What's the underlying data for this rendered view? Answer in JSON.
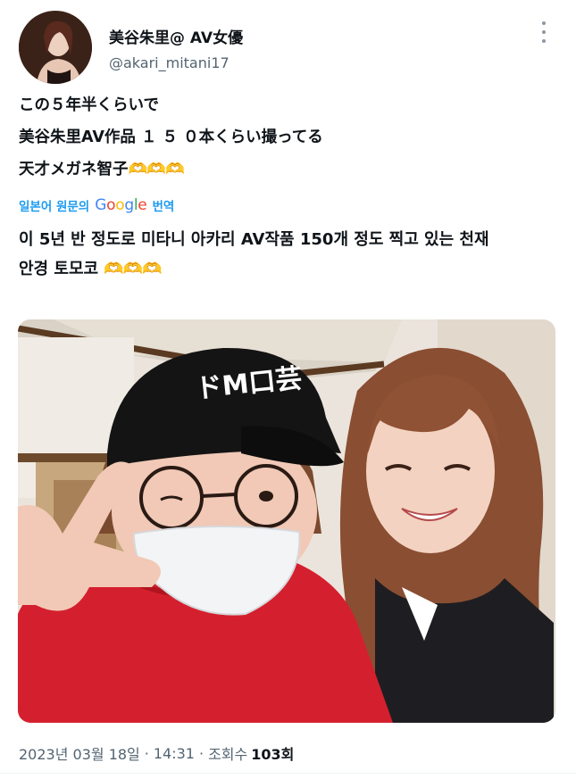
{
  "author": {
    "display_name": "美谷朱里@ AV女優",
    "handle": "@akari_mitani17"
  },
  "tweet": {
    "lines": [
      "この５年半くらいで",
      "美谷朱里AV作品 １ ５ ０本くらい撮ってる",
      "天才メガネ智子"
    ],
    "heart_hands_emoji": "🫶🫶🫶"
  },
  "translate": {
    "prefix": "일본어 원문의",
    "brand": "Google",
    "suffix": "번역"
  },
  "translation": {
    "lines": [
      "이 5년 반 정도로 미타니 아카리 AV작품 150개 정도 찍고 있는 천재",
      "안경 토모코"
    ]
  },
  "photo": {
    "cap_text": "ドM口芸"
  },
  "meta": {
    "date": "2023년 03월 18일",
    "separator": "·",
    "time": "14:31",
    "views_label": "조회수",
    "views": "103회"
  },
  "colors": {
    "link": "#1d9bf0",
    "secondary_text": "#536471",
    "primary_text": "#0f1419",
    "hoodie_red": "#d4202e",
    "cap_black": "#141414"
  }
}
